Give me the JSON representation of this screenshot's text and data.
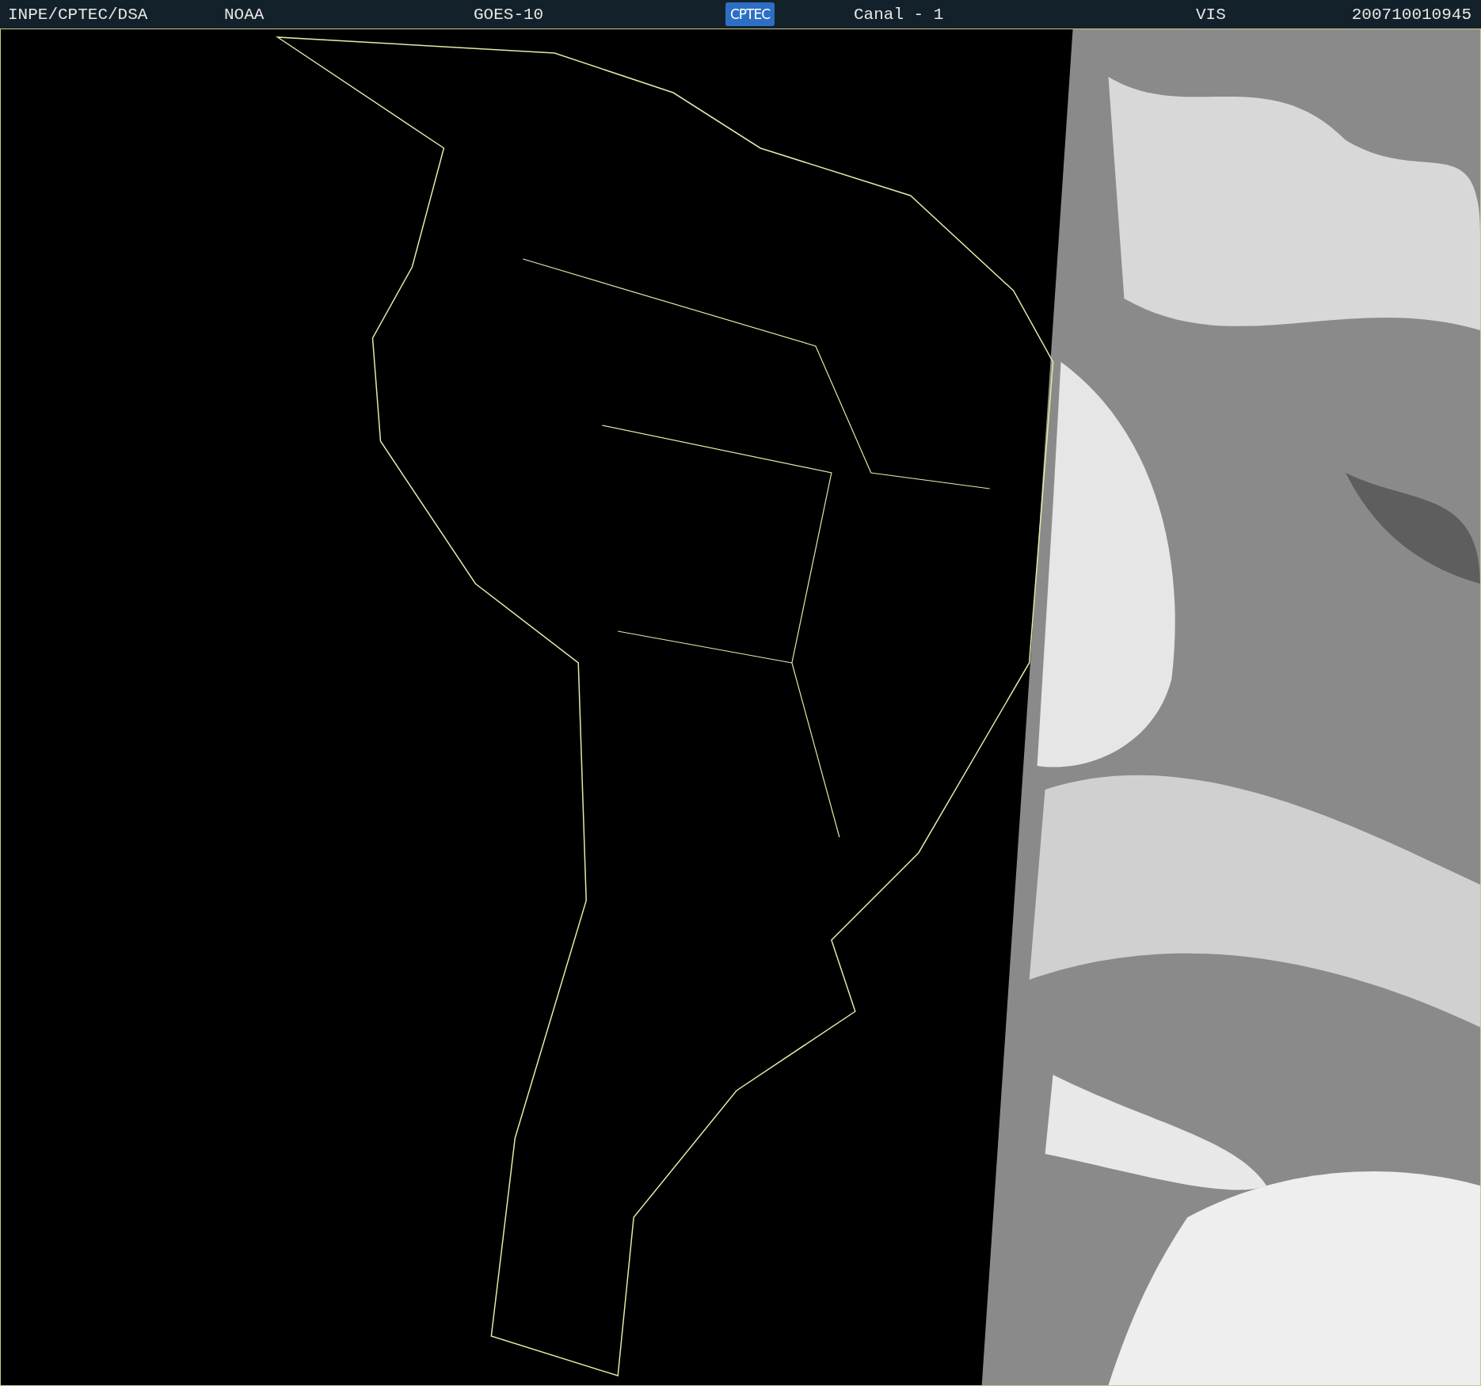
{
  "header": {
    "items": [
      {
        "kind": "text",
        "text": "INPE/CPTEC/DSA"
      },
      {
        "kind": "text",
        "text": "NOAA"
      },
      {
        "kind": "text",
        "text": "GOES-10"
      },
      {
        "kind": "logo",
        "text": "CPTEC"
      },
      {
        "kind": "text",
        "text": "Canal - 1"
      },
      {
        "kind": "text",
        "text": "VIS"
      },
      {
        "kind": "text",
        "text": "200710010945"
      }
    ]
  }
}
